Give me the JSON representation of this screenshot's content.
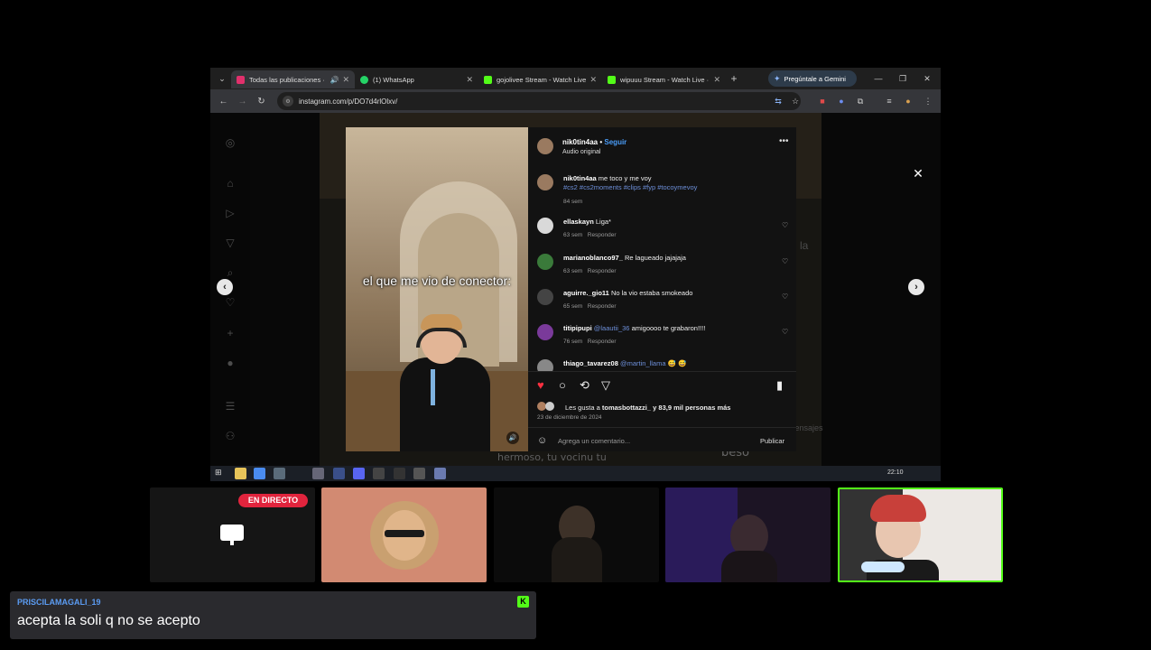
{
  "browser": {
    "tabs": [
      {
        "title": "Todas las publicaciones ·",
        "color": "#e1306c",
        "active": true
      },
      {
        "title": "(1) WhatsApp",
        "color": "#25d366",
        "active": false
      },
      {
        "title": "gojolivee Stream - Watch Live",
        "color": "#53fc18",
        "active": false
      },
      {
        "title": "wipuuu Stream - Watch Live ·",
        "color": "#53fc18",
        "active": false
      }
    ],
    "gemini_label": "Pregúntale a Gemini",
    "url": "instagram.com/p/DO7d4rlOlxv/"
  },
  "post": {
    "author": "nik0tin4aa",
    "follow_label": "Seguir",
    "audio": "Audio original",
    "caption_text": "me toco y me voy",
    "caption_tags": "#cs2 #cs2moments #clips #fyp #tocoymevoy",
    "caption_time": "84 sem",
    "video_caption": "el que me vio de conector:",
    "comments": [
      {
        "user": "ellaskayn",
        "text": "Liga*",
        "time": "63 sem",
        "reply": "Responder",
        "avatar": "#d9d9d9"
      },
      {
        "user": "marianoblanco97_",
        "text": "Re lagueado jajajaja",
        "time": "63 sem",
        "reply": "Responder",
        "avatar": "#3a7a3a"
      },
      {
        "user": "aguirre._gio11",
        "text": "No la vio estaba smokeado",
        "time": "65 sem",
        "reply": "Responder",
        "avatar": "#444"
      },
      {
        "user": "titipipupi",
        "mention": "@laautii_36",
        "text": "amigoooo te grabaron!!!!",
        "time": "76 sem",
        "reply": "Responder",
        "avatar": "#7a3a9a"
      }
    ],
    "partial_comment": {
      "user": "thiago_tavarez08",
      "mention": "@martin_llama",
      "emoji": "😅 😅"
    },
    "likes_prefix": "Les gusta a",
    "likes_user": "tomasbottazzi_",
    "likes_suffix": "y 83,9 mil personas más",
    "date": "23 de diciembre de 2024",
    "comment_placeholder": "Agrega un comentario...",
    "publish_label": "Publicar"
  },
  "background": {
    "la": "la",
    "mensajes": "Mensajes",
    "caption": "hermoso, tu vocinu tu",
    "beso": "beso"
  },
  "taskbar": {
    "time": "22:10"
  },
  "stream": {
    "live_label": "EN DIRECTO",
    "chat_user": "PRISCILAMAGALI_19",
    "chat_message": "acepta la soli q no se acepto",
    "kick_logo": "K"
  }
}
